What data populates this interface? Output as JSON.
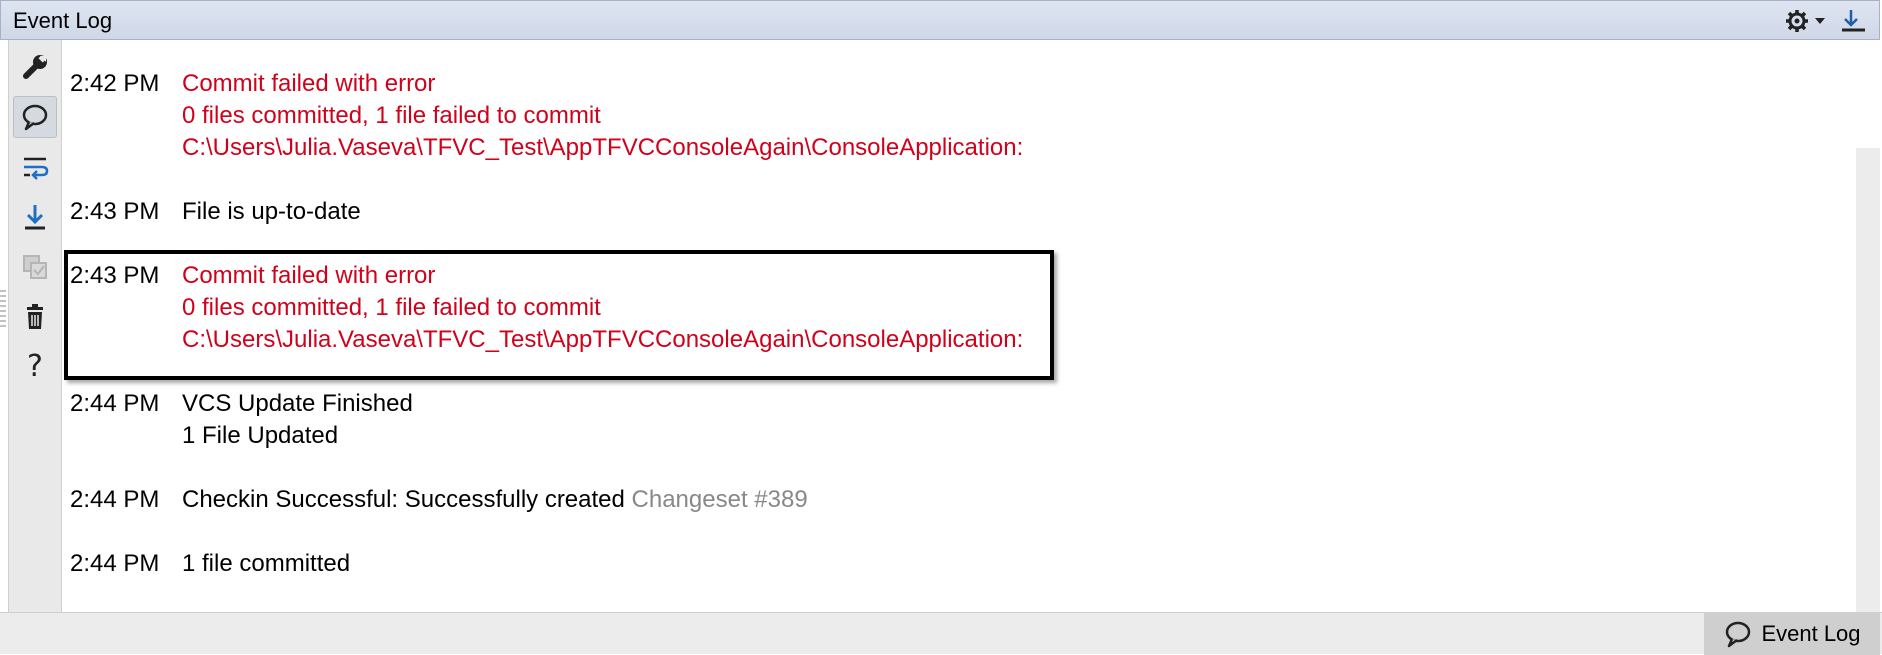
{
  "window": {
    "title": "Event Log"
  },
  "titlebar_icons": {
    "settings": "gear-icon",
    "hide": "hide-icon"
  },
  "toolbar": [
    {
      "name": "wrench-icon"
    },
    {
      "name": "speech-bubble-icon"
    },
    {
      "name": "wrap-icon"
    },
    {
      "name": "scroll-to-end-icon"
    },
    {
      "name": "mark-as-read-icon"
    },
    {
      "name": "trash-icon"
    },
    {
      "name": "help-icon",
      "glyph": "?"
    }
  ],
  "entries": [
    {
      "time": "2:42 PM",
      "status": "error",
      "lines": [
        "Commit failed with error",
        "0 files committed, 1 file failed to commit",
        "C:\\Users\\Julia.Vaseva\\TFVC_Test\\AppTFVCConsoleAgain\\ConsoleApplication:"
      ]
    },
    {
      "time": "2:43 PM",
      "status": "ok",
      "lines": [
        "File is up-to-date"
      ]
    },
    {
      "time": "2:43 PM",
      "status": "error",
      "lines": [
        "Commit failed with error",
        "0 files committed, 1 file failed to commit",
        "C:\\Users\\Julia.Vaseva\\TFVC_Test\\AppTFVCConsoleAgain\\ConsoleApplication:"
      ]
    },
    {
      "time": "2:44 PM",
      "status": "ok",
      "lines": [
        "VCS Update Finished",
        "1 File Updated"
      ]
    },
    {
      "time": "2:44 PM",
      "status": "ok",
      "text": "Checkin Successful: Successfully created ",
      "link": "Changeset #389"
    },
    {
      "time": "2:44 PM",
      "status": "ok",
      "lines": [
        "1 file committed"
      ]
    }
  ],
  "statusbar": {
    "tab_label": "Event Log"
  },
  "colors": {
    "error": "#d0021b",
    "link": "#888888",
    "titlebar": "#dfe5f1"
  }
}
